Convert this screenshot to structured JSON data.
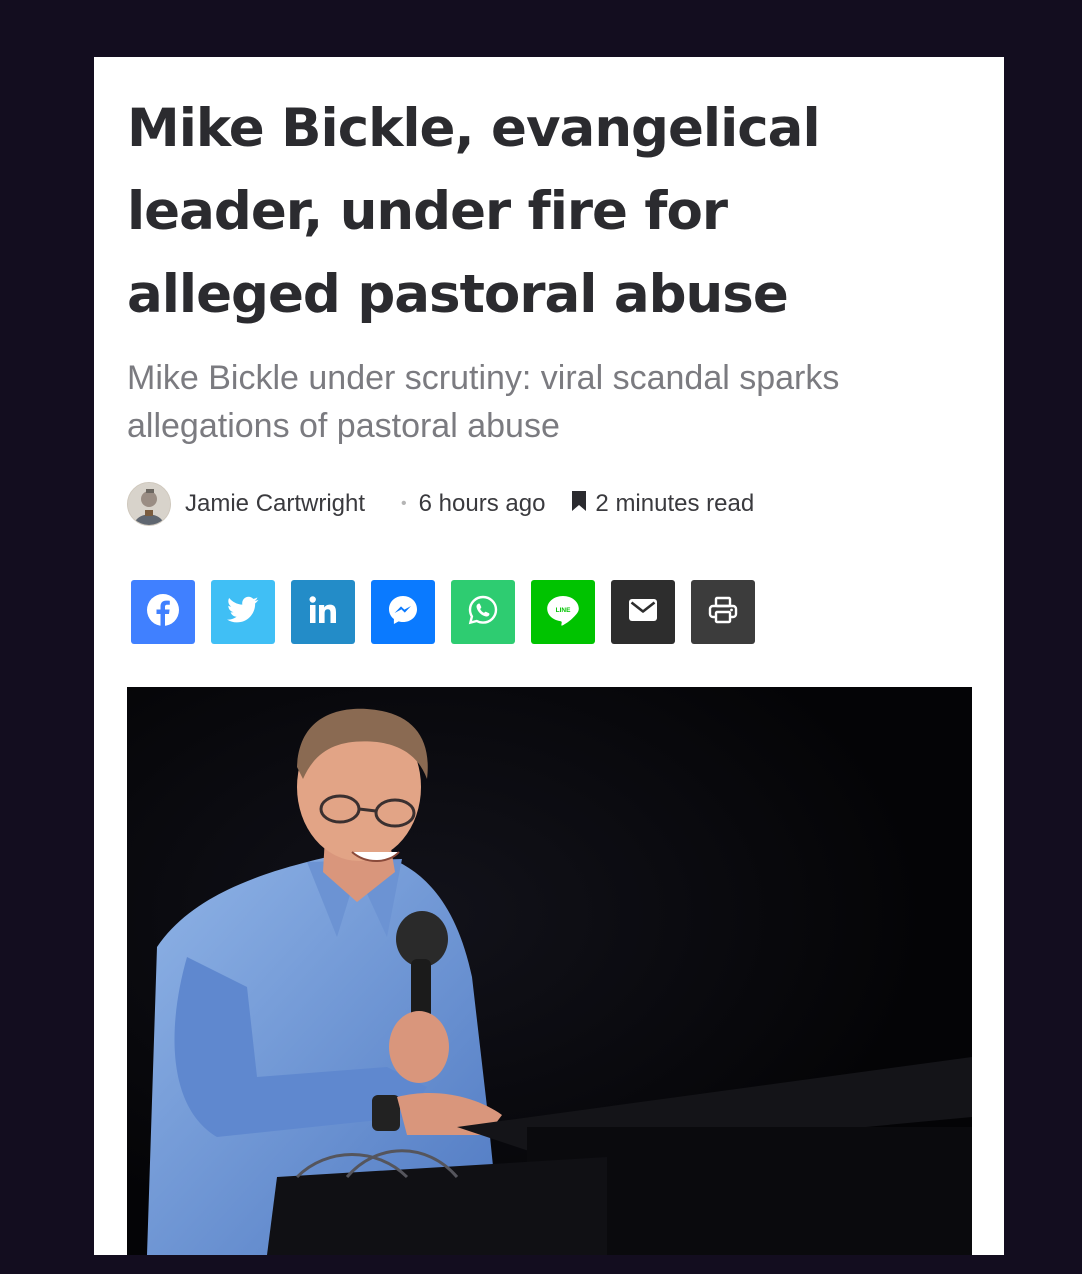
{
  "article": {
    "title": "Mike Bickle, evangelical leader, under fire for alleged pastoral abuse",
    "subtitle": "Mike Bickle under scrutiny: viral scandal sparks allegations of pastoral abuse",
    "author": "Jamie Cartwright",
    "separator": "•",
    "published": "6 hours ago",
    "read_time": "2 minutes read"
  },
  "share": [
    {
      "name": "facebook",
      "icon": "facebook-icon",
      "color": "#4080ff"
    },
    {
      "name": "twitter",
      "icon": "twitter-icon",
      "color": "#40bff5"
    },
    {
      "name": "linkedin",
      "icon": "linkedin-icon",
      "color": "#238cc8"
    },
    {
      "name": "messenger",
      "icon": "messenger-icon",
      "color": "#0a7aff"
    },
    {
      "name": "whatsapp",
      "icon": "whatsapp-icon",
      "color": "#2ecc71"
    },
    {
      "name": "line",
      "icon": "line-icon",
      "color": "#00c300",
      "icon_text": "LINE"
    },
    {
      "name": "email",
      "icon": "envelope-icon",
      "color": "#2d2d2d"
    },
    {
      "name": "print",
      "icon": "printer-icon",
      "color": "#3c3c3c"
    }
  ],
  "colors": {
    "page_background": "#130d1f",
    "card_background": "#ffffff",
    "title": "#2b2b2f",
    "subtitle": "#7b7b80"
  }
}
